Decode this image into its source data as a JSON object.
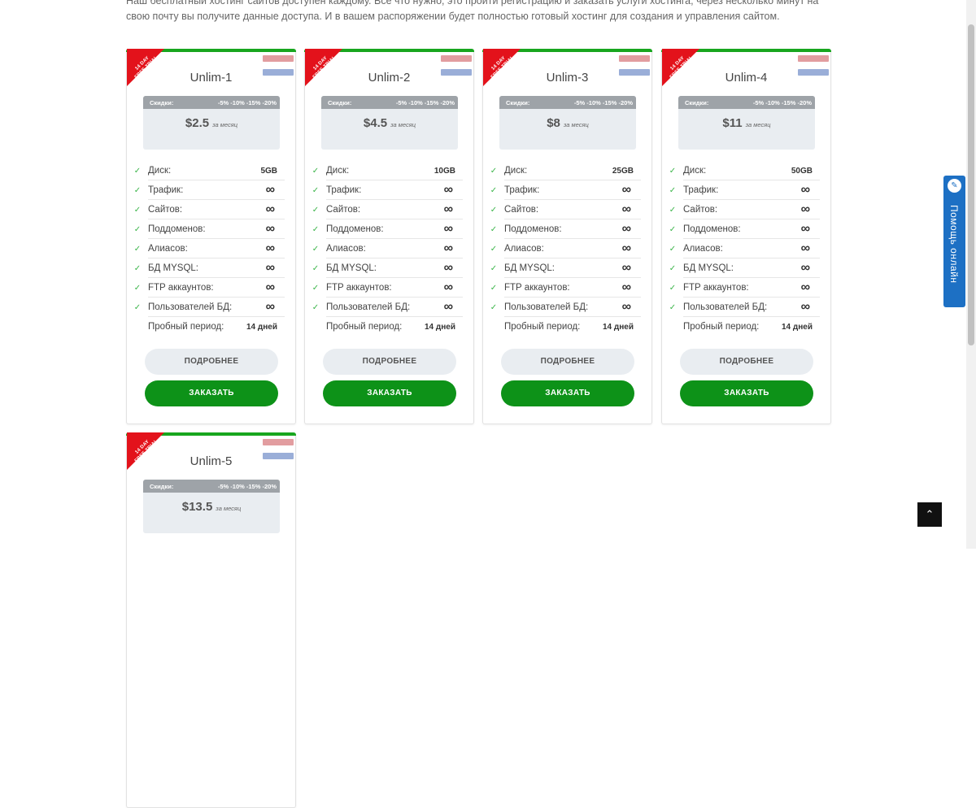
{
  "intro": {
    "text": "Наш бесплатный хостинг сайтов доступен каждому. Все что нужно, это пройти регистрацию и заказать услуги хостинга, через несколько минут на свою почту вы получите данные доступа. И в вашем распоряжении будет полностью готовый хостинг для создания и управления сайтом."
  },
  "labels": {
    "ribbon": "14 DAY FREE TRIAL",
    "discount_label": "Скидки:",
    "discount_values": "-5% -10% -15% -20%",
    "per_month": "за месяц",
    "more_button": "ПОДРОБНЕЕ",
    "order_button": "ЗАКАЗАТЬ",
    "infinity": "∞",
    "check": "✓"
  },
  "feature_labels": {
    "disk": "Диск:",
    "traffic": "Трафик:",
    "sites": "Сайтов:",
    "subdomains": "Поддоменов:",
    "aliases": "Алиасов:",
    "mysql": "БД MYSQL:",
    "ftp": "FTP аккаунтов:",
    "db_users": "Пользователей БД:",
    "trial": "Пробный период:"
  },
  "plans": [
    {
      "name": "Unlim-1",
      "price": "$2.5",
      "disk": "5GB",
      "trial": "14 дней"
    },
    {
      "name": "Unlim-2",
      "price": "$4.5",
      "disk": "10GB",
      "trial": "14 дней"
    },
    {
      "name": "Unlim-3",
      "price": "$8",
      "disk": "25GB",
      "trial": "14 дней"
    },
    {
      "name": "Unlim-4",
      "price": "$11",
      "disk": "50GB",
      "trial": "14 дней"
    },
    {
      "name": "Unlim-5",
      "price": "$13.5",
      "disk": "",
      "trial": ""
    }
  ],
  "help": {
    "icon": "chat-icon",
    "text": "Помощь онлайн"
  },
  "colors": {
    "accent_green": "#0d9218",
    "ribbon_red": "#e3121b",
    "help_blue": "#1d70c4"
  }
}
